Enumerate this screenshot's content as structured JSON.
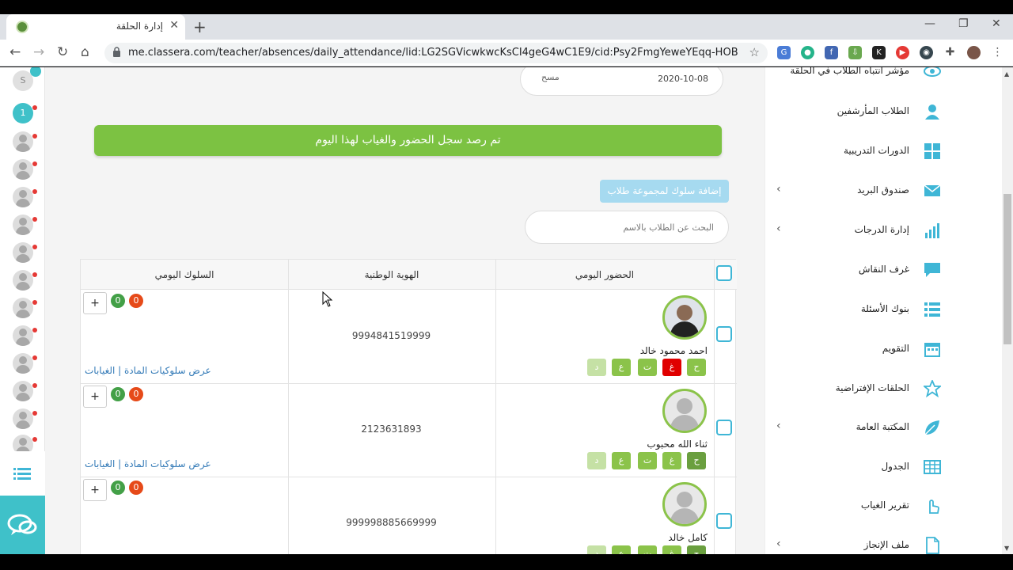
{
  "browser": {
    "tab_title": "إدارة الحلقة",
    "url": "me.classera.com/teacher/absences/daily_attendance/lid:LG2SGVicwkwcKsCI4geG4wC1E9/cid:Psy2FmgYeweYEqq-HOBgRwC1E9/tid:..."
  },
  "header": {
    "date": "2020-10-08",
    "clear_label": "مسح"
  },
  "banner": "تم رصد سجل الحضور والغياب لهذا اليوم",
  "group_behavior_button": "إضافة سلوك لمجموعة طلاب",
  "search": {
    "placeholder": "البحث عن الطلاب بالاسم"
  },
  "table": {
    "headers": {
      "attendance": "الحضور اليومي",
      "national_id": "الهوية الوطنية",
      "behavior": "السلوك اليومي"
    },
    "attendance_codes": [
      "ح",
      "غ",
      "ت",
      "ع",
      "د"
    ],
    "rows": [
      {
        "name": "احمد محمود خالد",
        "national_id": "9994841519999",
        "positive": "0",
        "negative": "0",
        "link": "عرض سلوكيات المادة | الغيابات",
        "selected": "غ"
      },
      {
        "name": "ثناء الله محبوب",
        "national_id": "2123631893",
        "positive": "0",
        "negative": "0",
        "link": "عرض سلوكيات المادة | الغيابات",
        "selected": "ح"
      },
      {
        "name": "كامل خالد",
        "national_id": "999998885669999",
        "positive": "0",
        "negative": "0",
        "link": "",
        "selected": "ح"
      }
    ],
    "plus_label": "+"
  },
  "rail": {
    "top_initial": "S",
    "badge": "1"
  },
  "sidebar": {
    "items": [
      {
        "label": "مؤشر انتباه الطلاب في الحلقة",
        "icon": "eye-icon",
        "chevron": false
      },
      {
        "label": "الطلاب المأرشفين",
        "icon": "user-icon",
        "chevron": false
      },
      {
        "label": "الدورات التدريبية",
        "icon": "grid-icon",
        "chevron": false
      },
      {
        "label": "صندوق البريد",
        "icon": "mail-icon",
        "chevron": true
      },
      {
        "label": "إدارة الدرجات",
        "icon": "bar-chart-icon",
        "chevron": true
      },
      {
        "label": "غرف النقاش",
        "icon": "chat-bubble-icon",
        "chevron": false
      },
      {
        "label": "بنوك الأسئلة",
        "icon": "list-icon",
        "chevron": false
      },
      {
        "label": "التقويم",
        "icon": "calendar-icon",
        "chevron": false
      },
      {
        "label": "الحلقات الإفتراضية",
        "icon": "star-icon",
        "chevron": false
      },
      {
        "label": "المكتبة العامة",
        "icon": "leaf-icon",
        "chevron": true
      },
      {
        "label": "الجدول",
        "icon": "table-icon",
        "chevron": false
      },
      {
        "label": "تقرير الغياب",
        "icon": "hand-icon",
        "chevron": false
      },
      {
        "label": "ملف الإنجاز",
        "icon": "file-icon",
        "chevron": true
      }
    ]
  },
  "colors": {
    "accent": "#3fb6d6",
    "green": "#7cc242",
    "red": "#e53935",
    "sidebar_icon": "#3fb6d6"
  }
}
